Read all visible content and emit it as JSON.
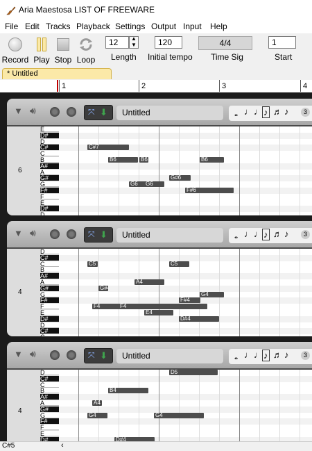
{
  "window": {
    "title": "Aria Maestosa  LIST OF FREEWARE"
  },
  "menu": [
    "File",
    "Edit",
    "Tracks",
    "Playback",
    "Settings",
    "Output",
    "Input",
    "Help"
  ],
  "toolbar": {
    "record": "Record",
    "play": "Play",
    "stop": "Stop",
    "loop": "Loop",
    "length_value": "12",
    "length_label": "Length",
    "tempo_value": "120",
    "tempo_label": "Initial tempo",
    "timesig_value": "4/4",
    "timesig_label": "Time Sig",
    "start_value": "1",
    "start_label": "Start"
  },
  "tab": {
    "label": "* Untitled"
  },
  "ruler": [
    "1",
    "2",
    "3",
    "4"
  ],
  "tracks": [
    {
      "name": "Untitled",
      "octave": "6",
      "keys": [
        "E",
        "D#",
        "D",
        "C#",
        "C",
        "B",
        "A#",
        "A",
        "G#",
        "G",
        "F#",
        "F",
        "E",
        "D#",
        "D"
      ],
      "notes": [
        {
          "label": "C#7",
          "row": 3,
          "start": 0.22,
          "len": 0.52
        },
        {
          "label": "B6",
          "row": 5,
          "start": 0.74,
          "len": 0.37
        },
        {
          "label": "B6",
          "row": 5,
          "start": 1.52,
          "len": 0.11
        },
        {
          "label": "B6",
          "row": 5,
          "start": 3.02,
          "len": 0.3
        },
        {
          "label": "G6",
          "row": 9,
          "start": 1.25,
          "len": 0.38
        },
        {
          "label": "G6",
          "row": 9,
          "start": 1.63,
          "len": 0.25
        },
        {
          "label": "G#6",
          "row": 8,
          "start": 2.25,
          "len": 0.27
        },
        {
          "label": "F#6",
          "row": 10,
          "start": 2.65,
          "len": 0.6
        }
      ]
    },
    {
      "name": "Untitled",
      "octave": "4",
      "keys": [
        "D",
        "C#",
        "C",
        "B",
        "A#",
        "A",
        "G#",
        "G",
        "F#",
        "F",
        "E",
        "D#",
        "D",
        "C#",
        "C"
      ],
      "notes": [
        {
          "label": "C5",
          "row": 2,
          "start": 0.22,
          "len": 0.13
        },
        {
          "label": "C5",
          "row": 2,
          "start": 2.25,
          "len": 0.25
        },
        {
          "label": "A4",
          "row": 5,
          "start": 1.4,
          "len": 0.37
        },
        {
          "label": "G#4",
          "row": 6,
          "start": 0.5,
          "len": 0.12
        },
        {
          "label": "G4",
          "row": 7,
          "start": 3.02,
          "len": 0.3
        },
        {
          "label": "F#4",
          "row": 8,
          "start": 2.5,
          "len": 0.27
        },
        {
          "label": "F4",
          "row": 9,
          "start": 0.35,
          "len": 0.38
        },
        {
          "label": "F4",
          "row": 9,
          "start": 1.0,
          "len": 1.1
        },
        {
          "label": "E4",
          "row": 10,
          "start": 1.63,
          "len": 0.36
        },
        {
          "label": "D#4",
          "row": 11,
          "start": 2.5,
          "len": 0.5
        }
      ]
    },
    {
      "name": "Untitled",
      "octave": "4",
      "keys": [
        "D",
        "C#",
        "C",
        "B",
        "A#",
        "A",
        "G#",
        "G",
        "F#",
        "F",
        "E",
        "D#",
        "D"
      ],
      "notes": [
        {
          "label": "D5",
          "row": 0,
          "start": 2.25,
          "len": 0.6
        },
        {
          "label": "B4",
          "row": 3,
          "start": 0.74,
          "len": 0.5
        },
        {
          "label": "A4",
          "row": 5,
          "start": 0.35,
          "len": 0.12
        },
        {
          "label": "G4",
          "row": 7,
          "start": 0.22,
          "len": 0.25
        },
        {
          "label": "G4",
          "row": 7,
          "start": 1.88,
          "len": 0.62
        },
        {
          "label": "D#4",
          "row": 11,
          "start": 0.9,
          "len": 0.5
        },
        {
          "label": "D4",
          "row": 12,
          "start": 1.63,
          "len": 0.5
        }
      ]
    }
  ],
  "status": {
    "note": "C#5"
  }
}
